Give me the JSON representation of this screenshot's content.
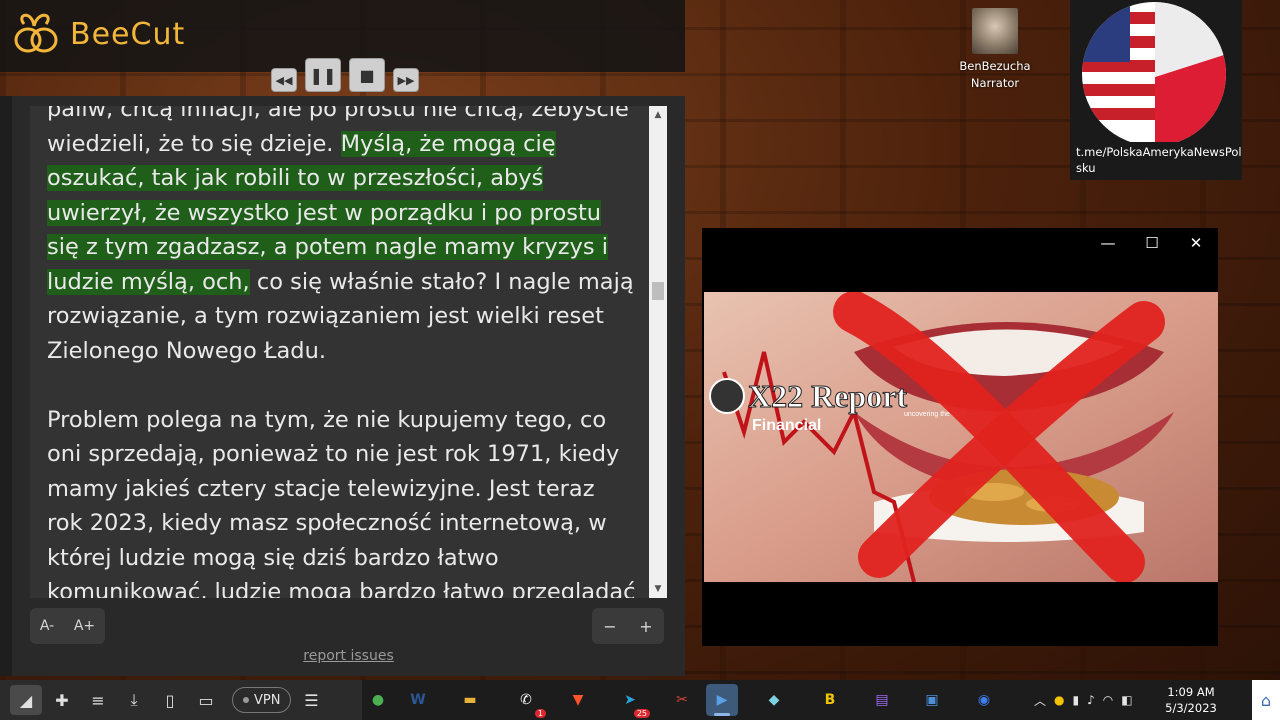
{
  "app": {
    "name": "BeeCut",
    "brand_color": "#f2b73a"
  },
  "media_controls": {
    "rewind_icon": "rewind-icon",
    "pause_icon": "pause-icon",
    "stop_icon": "stop-icon",
    "forward_icon": "fast-forward-icon"
  },
  "reader": {
    "paragraphs": [
      {
        "segments": [
          {
            "text": "paliw, chcą inflacji, ale po prostu nie chcą, żebyście wiedzieli, że to się dzieje. ",
            "highlight": false
          },
          {
            "text": "Myślą, że mogą cię oszukać, tak jak robili to w przeszłości, abyś uwierzył, że wszystko jest w porządku i po prostu się z tym zgadzasz, a potem nagle mamy kryzys i ludzie myślą, och,",
            "highlight": true
          },
          {
            "text": " co się właśnie stało? I nagle mają rozwiązanie, a tym rozwiązaniem jest wielki reset Zielonego Nowego Ładu.",
            "highlight": false
          }
        ]
      },
      {
        "segments": [
          {
            "text": "Problem polega na tym, że nie kupujemy tego, co oni sprzedają, ponieważ to nie jest rok 1971, kiedy mamy jakieś cztery stacje telewizyjne. Jest teraz rok 2023, kiedy masz społeczność internetową, w której ludzie mogą się dziś bardzo łatwo komunikować, ludzie mogą bardzo łatwo przeglądać różne źródła",
            "highlight": false
          }
        ]
      }
    ],
    "highlight_color": "#1f5f1a",
    "font_decrease": "A-",
    "font_increase": "A+",
    "zoom_out": "−",
    "zoom_in": "+",
    "report_link": "report issues"
  },
  "desktop_icon": {
    "name": "BenBezucha",
    "subtitle": "Narrator"
  },
  "telegram_card": {
    "link": "t.me/PolskaAmerykaNewsPolsku"
  },
  "video": {
    "overlay_title": "X22 Report",
    "overlay_tagline": "uncovering the truth",
    "overlay_subtitle": "Financial",
    "cross_color": "#e0231f"
  },
  "browser_bar": {
    "vpn_label": "VPN"
  },
  "taskbar": {
    "apps": [
      {
        "name": "app-launcher-icon",
        "glyph": "●",
        "color": "#4caf50"
      },
      {
        "name": "word-icon",
        "glyph": "W",
        "color": "#2b5797"
      },
      {
        "name": "file-explorer-icon",
        "glyph": "▬",
        "color": "#e8b23a"
      },
      {
        "name": "whatsapp-icon",
        "glyph": "✆",
        "color": "#ffffff",
        "badge": "1"
      },
      {
        "name": "brave-icon",
        "glyph": "▼",
        "color": "#fb542b"
      },
      {
        "name": "telegram-icon",
        "glyph": "➤",
        "color": "#2aa3dd",
        "badge": "25"
      },
      {
        "name": "snipping-tool-icon",
        "glyph": "✂",
        "color": "#d8453b"
      },
      {
        "name": "beecut-taskbar-icon",
        "glyph": "▶",
        "color": "#5aa0e6",
        "active": true
      },
      {
        "name": "editor-icon",
        "glyph": "◆",
        "color": "#7fd0e0"
      },
      {
        "name": "bee-app-icon",
        "glyph": "B",
        "color": "#f2c300"
      },
      {
        "name": "clapperboard-icon",
        "glyph": "▤",
        "color": "#9b6cf0"
      },
      {
        "name": "photos-icon",
        "glyph": "▣",
        "color": "#4a8fd8"
      },
      {
        "name": "media-player-icon",
        "glyph": "◉",
        "color": "#3d7ef0"
      }
    ],
    "time": "1:09 AM",
    "date": "5/3/2023"
  }
}
